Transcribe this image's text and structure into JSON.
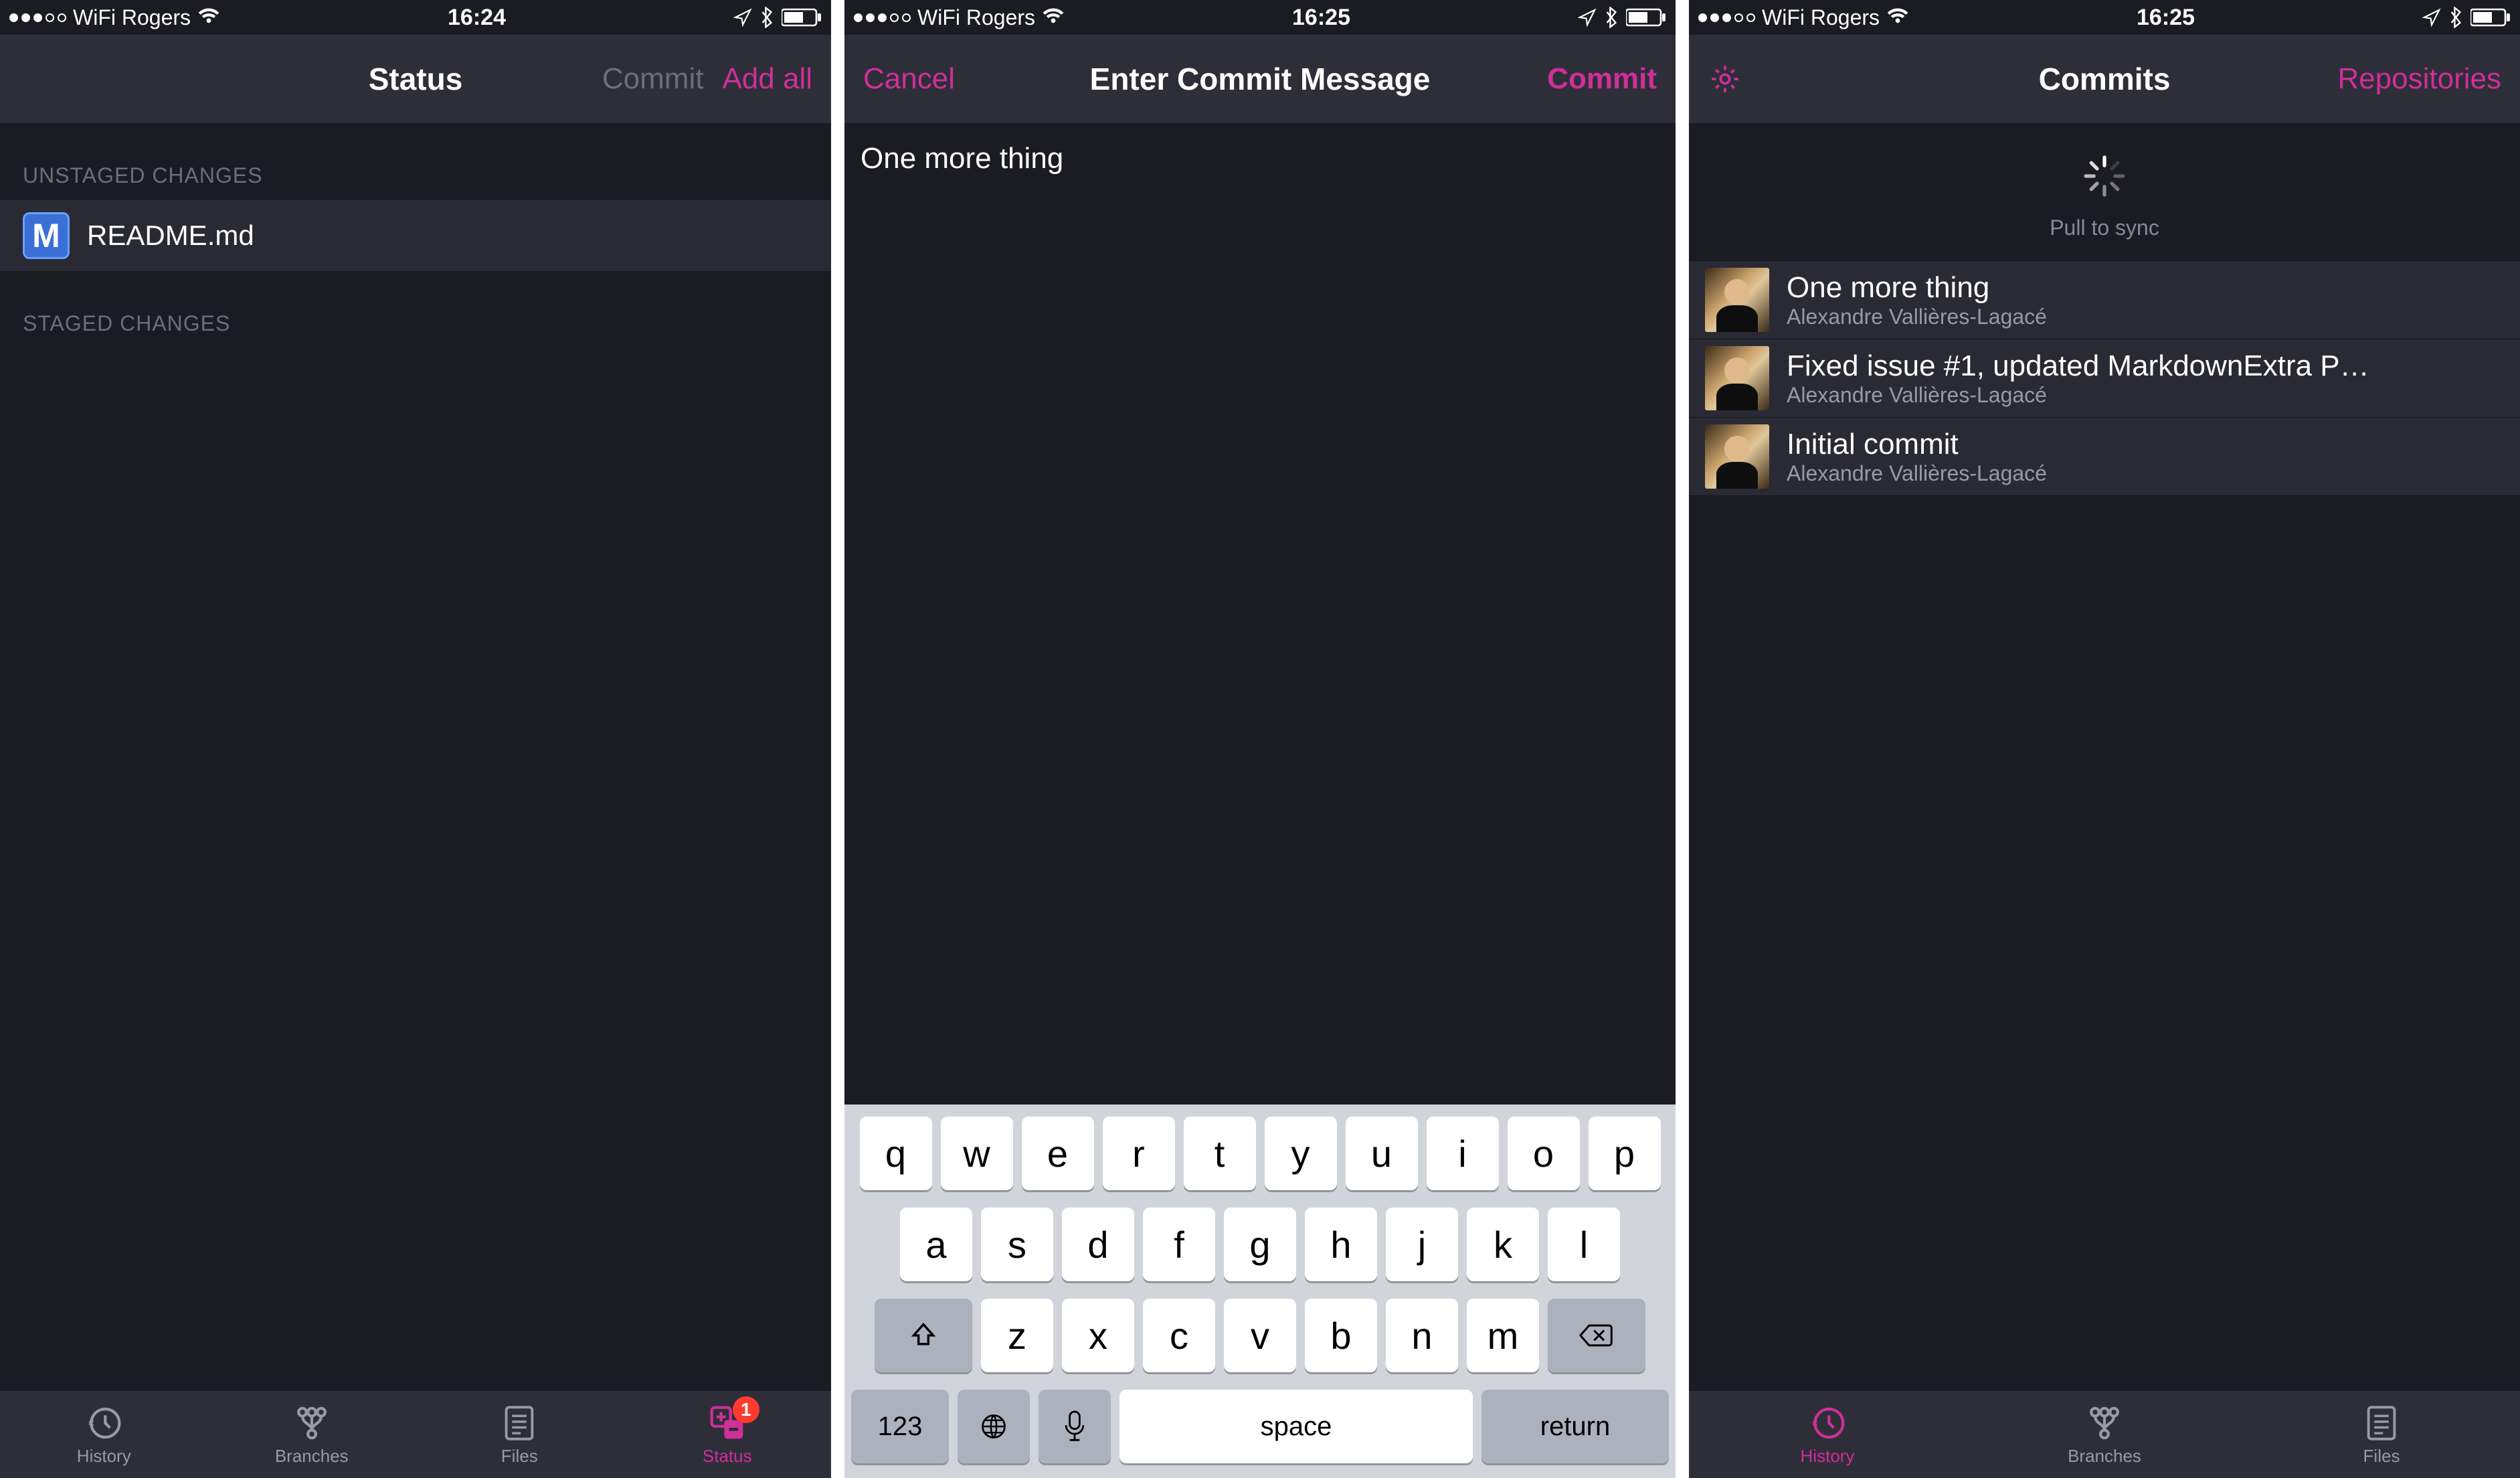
{
  "screen1": {
    "statusbar": {
      "carrier": "WiFi Rogers",
      "time": "16:24"
    },
    "nav": {
      "title": "Status",
      "commit": "Commit",
      "addall": "Add all"
    },
    "sections": {
      "unstaged": "UNSTAGED CHANGES",
      "staged": "STAGED CHANGES"
    },
    "files": [
      {
        "name": "README.md",
        "iconLetter": "M"
      }
    ],
    "tabs": {
      "history": "History",
      "branches": "Branches",
      "files": "Files",
      "status": "Status",
      "badge": "1"
    }
  },
  "screen2": {
    "statusbar": {
      "carrier": "WiFi Rogers",
      "time": "16:25"
    },
    "nav": {
      "cancel": "Cancel",
      "title": "Enter Commit Message",
      "commit": "Commit"
    },
    "message": "One more thing",
    "keyboard": {
      "row1": [
        "q",
        "w",
        "e",
        "r",
        "t",
        "y",
        "u",
        "i",
        "o",
        "p"
      ],
      "row2": [
        "a",
        "s",
        "d",
        "f",
        "g",
        "h",
        "j",
        "k",
        "l"
      ],
      "row3": [
        "z",
        "x",
        "c",
        "v",
        "b",
        "n",
        "m"
      ],
      "num": "123",
      "space": "space",
      "return": "return"
    }
  },
  "screen3": {
    "statusbar": {
      "carrier": "WiFi Rogers",
      "time": "16:25"
    },
    "nav": {
      "title": "Commits",
      "repos": "Repositories"
    },
    "pull": "Pull to sync",
    "commits": [
      {
        "title": "One more thing",
        "author": "Alexandre Vallières-Lagacé"
      },
      {
        "title": "Fixed issue #1, updated MarkdownExtra P…",
        "author": "Alexandre Vallières-Lagacé"
      },
      {
        "title": "Initial commit",
        "author": "Alexandre Vallières-Lagacé"
      }
    ],
    "tabs": {
      "history": "History",
      "branches": "Branches",
      "files": "Files"
    }
  }
}
